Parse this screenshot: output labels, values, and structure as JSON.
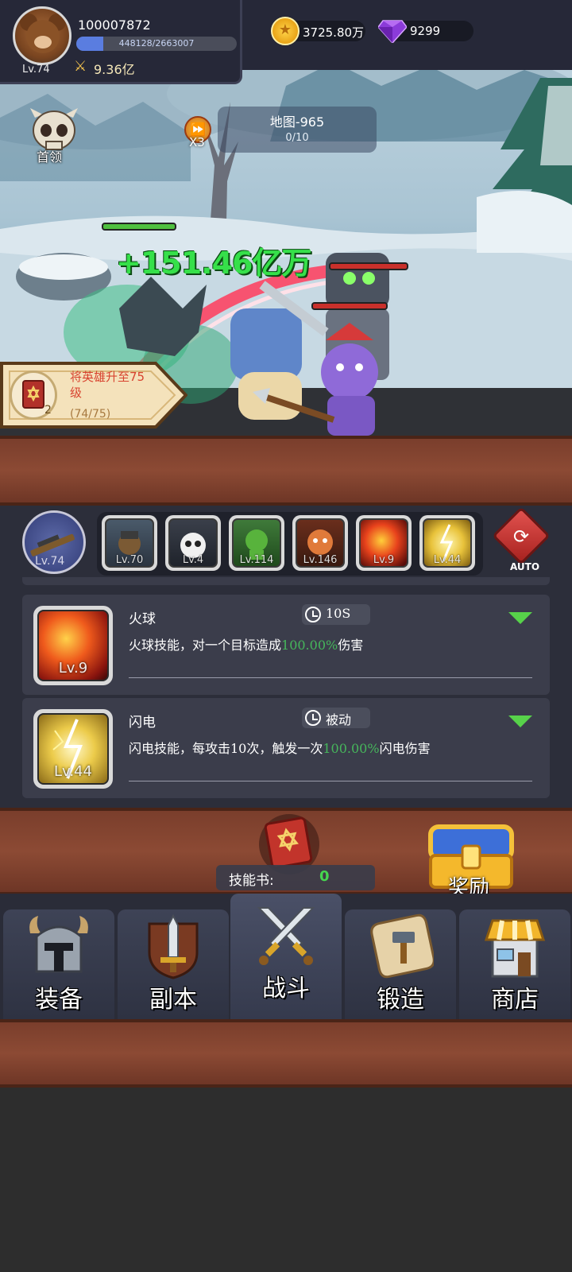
{
  "player": {
    "id": "100007872",
    "level": "Lv.74",
    "exp_text": "448128/2663007",
    "exp_progress": 0.168,
    "power": "9.36亿",
    "gold": "3725.80万",
    "gems": "9299"
  },
  "scene": {
    "boss_label": "首领",
    "speed_label": "X3",
    "map_name": "地图-965",
    "map_progress": "0/10",
    "damage_text": "+151.46亿万",
    "quest": {
      "text": "将英雄升至75级",
      "progress": "(74/75)",
      "count": "2"
    }
  },
  "skills": {
    "hero_level": "Lv.74",
    "slots": [
      {
        "level": "Lv.70",
        "icon": "cannon-icon"
      },
      {
        "level": "Lv.4",
        "icon": "bomb-skull-icon"
      },
      {
        "level": "Lv.114",
        "icon": "poison-icon"
      },
      {
        "level": "Lv.146",
        "icon": "monster-icon"
      },
      {
        "level": "Lv.9",
        "icon": "fireball-icon"
      },
      {
        "level": "Lv.44",
        "icon": "lightning-icon"
      }
    ],
    "auto_label": "AUTO",
    "cards": [
      {
        "title": "火球",
        "cooldown": "10S",
        "level": "Lv.9",
        "desc_before": "火球技能，对一个目标造成",
        "desc_highlight": "100.00%",
        "desc_after": "伤害"
      },
      {
        "title": "闪电",
        "cooldown": "被动",
        "level": "Lv.44",
        "desc_before": "闪电技能，每攻击10次，触发一次",
        "desc_highlight": "100.00%",
        "desc_after": "闪电伤害"
      }
    ]
  },
  "skill_book": {
    "label": "技能书:",
    "count": "0"
  },
  "reward_label": "奖励",
  "nav": {
    "equip": "装备",
    "dungeon": "副本",
    "battle": "战斗",
    "forge": "锻造",
    "shop": "商店"
  },
  "colors": {
    "highlight_green": "#46b65b",
    "damage_green": "#36e04a",
    "wood": "#8c4a34",
    "panel": "#3b3d4b"
  }
}
